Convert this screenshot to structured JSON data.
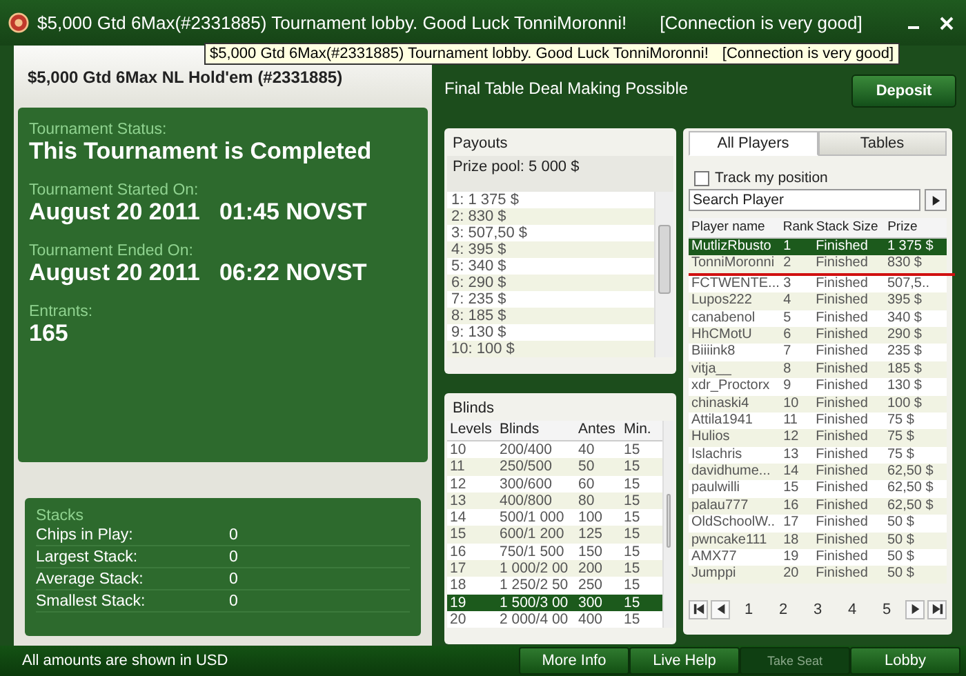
{
  "window": {
    "title": "$5,000 Gtd 6Max(#2331885) Tournament lobby. Good Luck TonniMoronni!",
    "connection": "[Connection is very good]"
  },
  "tooltip": {
    "text": "$5,000 Gtd 6Max(#2331885) Tournament lobby. Good Luck TonniMoronni!",
    "connection": "[Connection is very good]"
  },
  "tournament_name": "$5,000 Gtd 6Max NL Hold'em (#2331885)",
  "info": [
    {
      "label": "Tournament Status:",
      "value": "This Tournament is Completed"
    },
    {
      "label": "Tournament Started On:",
      "value": "August 20 2011   01:45 NOVST"
    },
    {
      "label": "Tournament Ended On:",
      "value": "August 20 2011   06:22 NOVST"
    },
    {
      "label": "Entrants:",
      "value": "165"
    }
  ],
  "stacks": {
    "title": "Stacks",
    "rows": [
      {
        "label": "Chips in Play:",
        "value": "0"
      },
      {
        "label": "Largest Stack:",
        "value": "0"
      },
      {
        "label": "Average Stack:",
        "value": "0"
      },
      {
        "label": "Smallest Stack:",
        "value": "0"
      }
    ]
  },
  "notice": "Final Table Deal Making Possible",
  "deposit": "Deposit",
  "payouts": {
    "title": "Payouts",
    "prize_pool": "Prize pool: 5 000 $",
    "items": [
      "1: 1 375 $",
      "2: 830 $",
      "3: 507,50 $",
      "4: 395 $",
      "5: 340 $",
      "6: 290 $",
      "7: 235 $",
      "8: 185 $",
      "9: 130 $",
      "10: 100 $"
    ]
  },
  "blinds": {
    "title": "Blinds",
    "columns": [
      "Levels",
      "Blinds",
      "Antes",
      "Min."
    ],
    "rows": [
      {
        "level": "10",
        "blinds": "200/400",
        "antes": "40",
        "min": "15",
        "selected": false
      },
      {
        "level": "11",
        "blinds": "250/500",
        "antes": "50",
        "min": "15",
        "selected": false
      },
      {
        "level": "12",
        "blinds": "300/600",
        "antes": "60",
        "min": "15",
        "selected": false
      },
      {
        "level": "13",
        "blinds": "400/800",
        "antes": "80",
        "min": "15",
        "selected": false
      },
      {
        "level": "14",
        "blinds": "500/1 000",
        "antes": "100",
        "min": "15",
        "selected": false
      },
      {
        "level": "15",
        "blinds": "600/1 200",
        "antes": "125",
        "min": "15",
        "selected": false
      },
      {
        "level": "16",
        "blinds": "750/1 500",
        "antes": "150",
        "min": "15",
        "selected": false
      },
      {
        "level": "17",
        "blinds": "1 000/2 00",
        "antes": "200",
        "min": "15",
        "selected": false
      },
      {
        "level": "18",
        "blinds": "1 250/2 50",
        "antes": "250",
        "min": "15",
        "selected": false
      },
      {
        "level": "19",
        "blinds": "1 500/3 00",
        "antes": "300",
        "min": "15",
        "selected": true
      },
      {
        "level": "20",
        "blinds": "2 000/4 00",
        "antes": "400",
        "min": "15",
        "selected": false
      }
    ]
  },
  "tabs": [
    {
      "label": "All Players",
      "selected": true
    },
    {
      "label": "Tables",
      "selected": false
    }
  ],
  "track": {
    "label": "Track my position",
    "checked": false
  },
  "search": {
    "value": "Search Player"
  },
  "players": {
    "columns": [
      "Player name",
      "Rank",
      "Stack Size",
      "Prize"
    ],
    "rows": [
      {
        "name": "MutlizRbusto",
        "rank": "1",
        "stack": "Finished",
        "prize": "1 375 $",
        "selected": true
      },
      {
        "name": "TonniMoronni",
        "rank": "2",
        "stack": "Finished",
        "prize": "830 $",
        "selected": false
      },
      {
        "name": "FCTWENTE...",
        "rank": "3",
        "stack": "Finished",
        "prize": "507,5..",
        "selected": false
      },
      {
        "name": "Lupos222",
        "rank": "4",
        "stack": "Finished",
        "prize": "395 $",
        "selected": false
      },
      {
        "name": "canabenol",
        "rank": "5",
        "stack": "Finished",
        "prize": "340 $",
        "selected": false
      },
      {
        "name": "HhCMotU",
        "rank": "6",
        "stack": "Finished",
        "prize": "290 $",
        "selected": false
      },
      {
        "name": "Biiiink8",
        "rank": "7",
        "stack": "Finished",
        "prize": "235 $",
        "selected": false
      },
      {
        "name": "vitja__",
        "rank": "8",
        "stack": "Finished",
        "prize": "185 $",
        "selected": false
      },
      {
        "name": "xdr_Proctorx",
        "rank": "9",
        "stack": "Finished",
        "prize": "130 $",
        "selected": false
      },
      {
        "name": "chinaski4",
        "rank": "10",
        "stack": "Finished",
        "prize": "100 $",
        "selected": false
      },
      {
        "name": "Attila1941",
        "rank": "11",
        "stack": "Finished",
        "prize": "75 $",
        "selected": false
      },
      {
        "name": "Hulios",
        "rank": "12",
        "stack": "Finished",
        "prize": "75 $",
        "selected": false
      },
      {
        "name": "Islachris",
        "rank": "13",
        "stack": "Finished",
        "prize": "75 $",
        "selected": false
      },
      {
        "name": "davidhume...",
        "rank": "14",
        "stack": "Finished",
        "prize": "62,50 $",
        "selected": false
      },
      {
        "name": "paulwilli",
        "rank": "15",
        "stack": "Finished",
        "prize": "62,50 $",
        "selected": false
      },
      {
        "name": "palau777",
        "rank": "16",
        "stack": "Finished",
        "prize": "62,50 $",
        "selected": false
      },
      {
        "name": "OldSchoolW..",
        "rank": "17",
        "stack": "Finished",
        "prize": "50 $",
        "selected": false
      },
      {
        "name": "pwncake111",
        "rank": "18",
        "stack": "Finished",
        "prize": "50 $",
        "selected": false
      },
      {
        "name": "AMX77",
        "rank": "19",
        "stack": "Finished",
        "prize": "50 $",
        "selected": false
      },
      {
        "name": "Jumppi",
        "rank": "20",
        "stack": "Finished",
        "prize": "50 $",
        "selected": false
      }
    ]
  },
  "pages": [
    "1",
    "2",
    "3",
    "4",
    "5"
  ],
  "footer": "All amounts are shown in USD",
  "buttons": [
    {
      "label": "More Info",
      "disabled": false
    },
    {
      "label": "Live Help",
      "disabled": false
    },
    {
      "label": "Take Seat",
      "disabled": true
    },
    {
      "label": "Lobby",
      "disabled": false
    }
  ]
}
